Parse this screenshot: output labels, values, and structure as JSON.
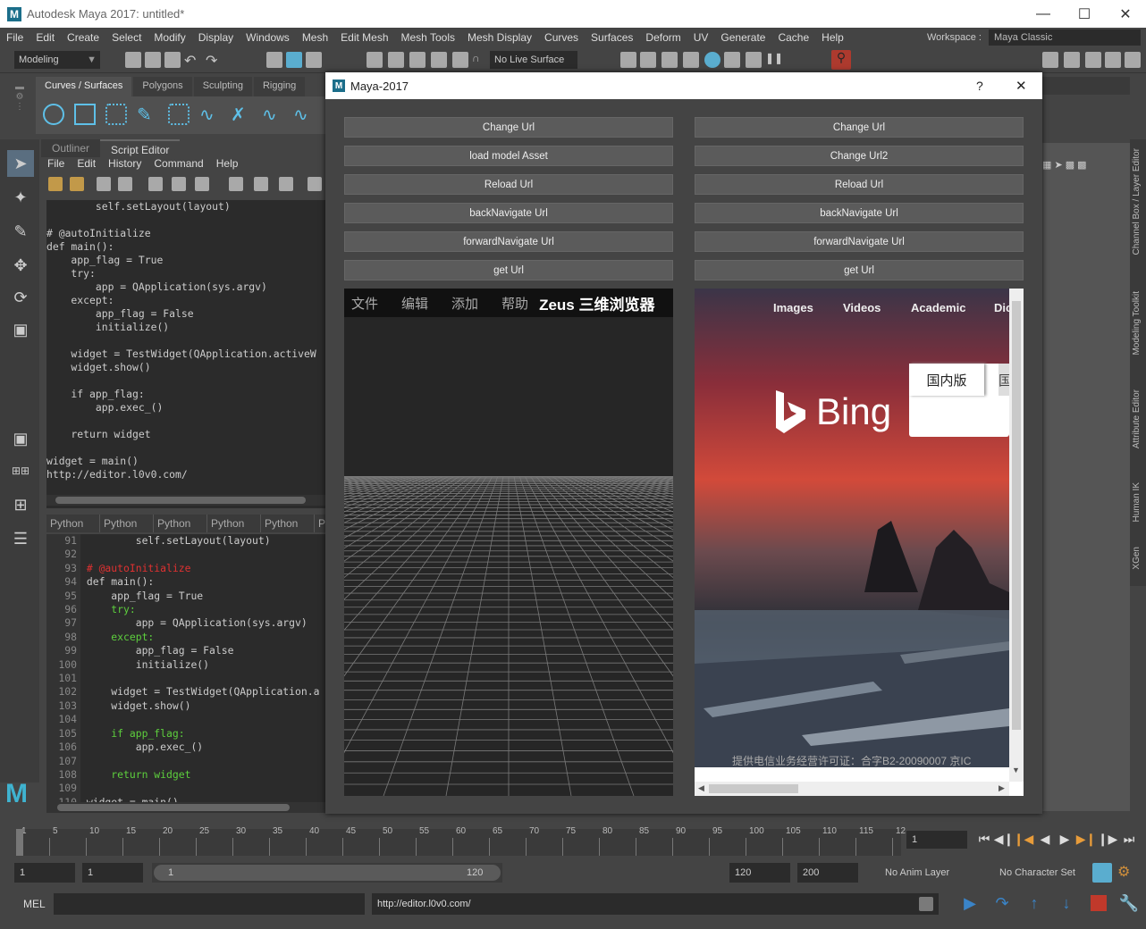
{
  "window": {
    "title": "Autodesk Maya 2017: untitled*",
    "logo": "M"
  },
  "menu": [
    "File",
    "Edit",
    "Create",
    "Select",
    "Modify",
    "Display",
    "Windows",
    "Mesh",
    "Edit Mesh",
    "Mesh Tools",
    "Mesh Display",
    "Curves",
    "Surfaces",
    "Deform",
    "UV",
    "Generate",
    "Cache",
    "Help"
  ],
  "workspace": {
    "label": "Workspace :",
    "value": "Maya Classic"
  },
  "toolbar": {
    "mode": "Modeling",
    "live_surface": "No Live Surface"
  },
  "shelf": {
    "tabs": [
      "Curves / Surfaces",
      "Polygons",
      "Sculpting",
      "Rigging"
    ]
  },
  "panel": {
    "tabs": [
      "Outliner",
      "Script Editor"
    ],
    "menu": [
      "File",
      "Edit",
      "History",
      "Command",
      "Help"
    ],
    "history_code": "        self.setLayout(layout)\n\n# @autoInitialize\ndef main():\n    app_flag = True\n    try:\n        app = QApplication(sys.argv)\n    except:\n        app_flag = False\n        initialize()\n\n    widget = TestWidget(QApplication.activeW\n    widget.show()\n\n    if app_flag:\n        app.exec_()\n\n    return widget\n\nwidget = main()\nhttp://editor.l0v0.com/",
    "py_tabs": [
      "Python",
      "Python",
      "Python",
      "Python",
      "Python",
      "P"
    ],
    "code_lines": [
      {
        "n": "91",
        "t": "        self.setLayout(layout)",
        "c": "nm"
      },
      {
        "n": "92",
        "t": "",
        "c": "nm"
      },
      {
        "n": "93",
        "t": "# @autoInitialize",
        "c": "dec"
      },
      {
        "n": "94",
        "t": "def main():",
        "c": "nm"
      },
      {
        "n": "95",
        "t": "    app_flag = True",
        "c": "nm"
      },
      {
        "n": "96",
        "t": "    try:",
        "c": "kw"
      },
      {
        "n": "97",
        "t": "        app = QApplication(sys.argv)",
        "c": "nm"
      },
      {
        "n": "98",
        "t": "    except:",
        "c": "kw"
      },
      {
        "n": "99",
        "t": "        app_flag = False",
        "c": "nm"
      },
      {
        "n": "100",
        "t": "        initialize()",
        "c": "nm"
      },
      {
        "n": "101",
        "t": "",
        "c": "nm"
      },
      {
        "n": "102",
        "t": "    widget = TestWidget(QApplication.a",
        "c": "nm"
      },
      {
        "n": "103",
        "t": "    widget.show()",
        "c": "nm"
      },
      {
        "n": "104",
        "t": "",
        "c": "nm"
      },
      {
        "n": "105",
        "t": "    if app_flag:",
        "c": "kw"
      },
      {
        "n": "106",
        "t": "        app.exec_()",
        "c": "nm"
      },
      {
        "n": "107",
        "t": "",
        "c": "nm"
      },
      {
        "n": "108",
        "t": "    return widget",
        "c": "kw"
      },
      {
        "n": "109",
        "t": "",
        "c": "nm"
      },
      {
        "n": "110",
        "t": "widget = main()",
        "c": "nm"
      }
    ]
  },
  "dialog": {
    "title": "Maya-2017",
    "help": "?",
    "close": "✕",
    "left_buttons": [
      "Change Url",
      "load model Asset",
      "Reload Url",
      "backNavigate Url",
      "forwardNavigate Url",
      "get Url"
    ],
    "right_buttons": [
      "Change Url",
      "Change Url2",
      "Reload Url",
      "backNavigate Url",
      "forwardNavigate Url",
      "get Url"
    ],
    "zeus_menu": [
      "文件",
      "编辑",
      "添加",
      "帮助"
    ],
    "zeus_title": "Zeus 三维浏览器",
    "bing_nav": [
      "Images",
      "Videos",
      "Academic",
      "Dic"
    ],
    "bing_logo": "Bing",
    "bing_tab": "国内版",
    "bing_tab2": "国",
    "bing_footer": "提供电信业务经营许可证：合字B2-20090007    京IC"
  },
  "right_strip": [
    "Channel Box / Layer Editor",
    "Modeling Toolkit",
    "Attribute Editor",
    "Human IK",
    "XGen"
  ],
  "timeline": {
    "ticks": [
      "1",
      "5",
      "10",
      "15",
      "20",
      "25",
      "30",
      "35",
      "40",
      "45",
      "50",
      "55",
      "60",
      "65",
      "70",
      "75",
      "80",
      "85",
      "90",
      "95",
      "100",
      "105",
      "110",
      "115",
      "12"
    ],
    "current_frame": "1"
  },
  "range": {
    "start": "1",
    "start2": "1",
    "slider_start": "1",
    "slider_end": "120",
    "end": "120",
    "end2": "200",
    "anim_layer": "No Anim Layer",
    "char_set": "No Character Set"
  },
  "cmd": {
    "lang": "MEL",
    "result": "http://editor.l0v0.com/"
  }
}
